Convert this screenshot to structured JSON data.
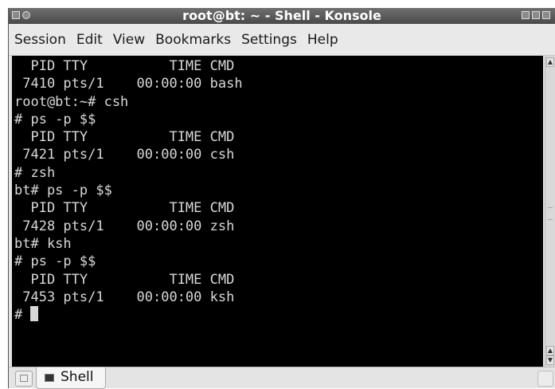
{
  "window": {
    "title": "root@bt: ~ - Shell - Konsole"
  },
  "menu": [
    "Session",
    "Edit",
    "View",
    "Bookmarks",
    "Settings",
    "Help"
  ],
  "terminal": {
    "lines": [
      "  PID TTY          TIME CMD",
      " 7410 pts/1    00:00:00 bash",
      "root@bt:~# csh",
      "# ps -p $$",
      "  PID TTY          TIME CMD",
      " 7421 pts/1    00:00:00 csh",
      "# zsh",
      "bt# ps -p $$",
      "  PID TTY          TIME CMD",
      " 7428 pts/1    00:00:00 zsh",
      "bt# ksh",
      "# ps -p $$",
      "  PID TTY          TIME CMD",
      " 7453 pts/1    00:00:00 ksh"
    ],
    "prompt": "# "
  },
  "tabs": [
    {
      "label": "Shell",
      "icon": "terminal-icon"
    }
  ],
  "icons": {
    "titlebar_left": [
      "window-menu-icon",
      "sticky-icon"
    ],
    "titlebar_right": [
      "minimize-icon",
      "maximize-icon",
      "close-icon"
    ],
    "tabbar_left": "new-tab-icon",
    "tabbar_right": "close-tab-icon"
  },
  "colors": {
    "titlebar": "#555555",
    "terminal_bg": "#000000",
    "terminal_fg": "#d8d8d8",
    "chrome": "#e4e4e4"
  }
}
